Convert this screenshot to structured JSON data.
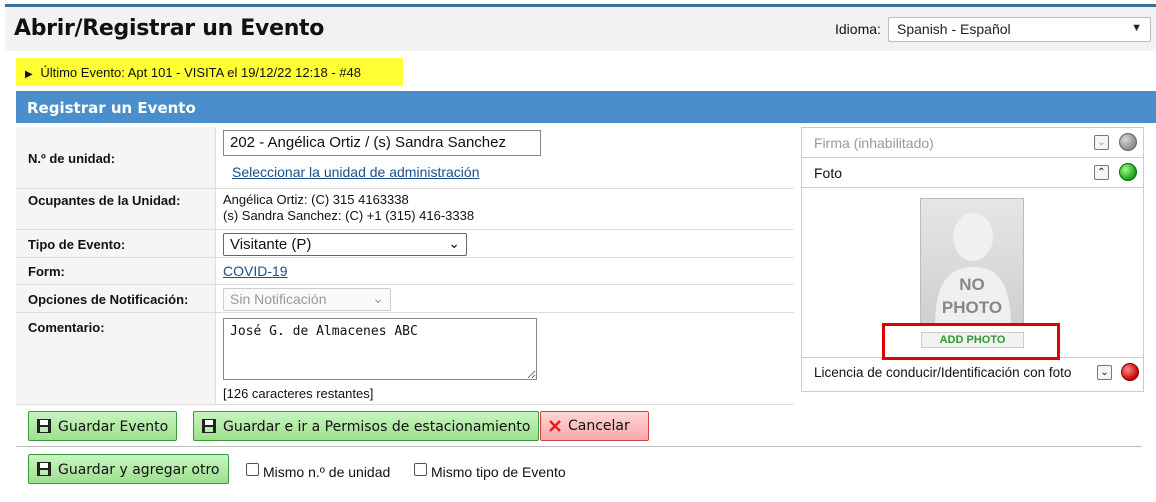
{
  "header": {
    "title": "Abrir/Registrar un Evento",
    "language_label": "Idioma:",
    "language_value": "Spanish - Español"
  },
  "last_event": {
    "text": "Último Evento: Apt 101 - VISITA el 19/12/22 12:18 - #48"
  },
  "panel": {
    "title": "Registrar un Evento"
  },
  "form": {
    "unit_label": "N.º de unidad:",
    "unit_value": "202 - Angélica Ortiz / (s) Sandra Sanchez",
    "select_admin_unit_link": "Seleccionar la unidad de administración",
    "occupants_label": "Ocupantes de la Unidad:",
    "occupants": [
      "Angélica Ortiz: (C) 315 4163338",
      "(s) Sandra Sanchez: (C) +1 (315) 416-3338"
    ],
    "event_type_label": "Tipo de Evento:",
    "event_type_value": "Visitante (P)",
    "form_label": "Form:",
    "form_link": "COVID-19",
    "notification_label": "Opciones de Notificación:",
    "notification_value": "Sin Notificación",
    "comment_label": "Comentario:",
    "comment_value": "José G. de Almacenes ABC",
    "chars_remaining": "[126 caracteres restantes]"
  },
  "side": {
    "signature_label": "Firma (inhabilitado)",
    "photo_label": "Foto",
    "nophoto_line1": "NO",
    "nophoto_line2": "PHOTO",
    "add_photo": "ADD PHOTO",
    "license_label": "Licencia de conducir/Identificación con foto"
  },
  "buttons": {
    "save": "Guardar Evento",
    "save_parking": "Guardar e ir a Permisos de estacionamiento",
    "cancel": "Cancelar",
    "save_add": "Guardar y agregar otro"
  },
  "checkboxes": {
    "same_unit": "Mismo n.º de unidad",
    "same_type": "Mismo tipo de Evento"
  },
  "colors": {
    "panel_header": "#4a8fcc",
    "last_event_bg": "#ffff33",
    "highlight_frame": "#e00000",
    "save_green": "#9ee08f",
    "cancel_red": "#f7aaaa"
  }
}
